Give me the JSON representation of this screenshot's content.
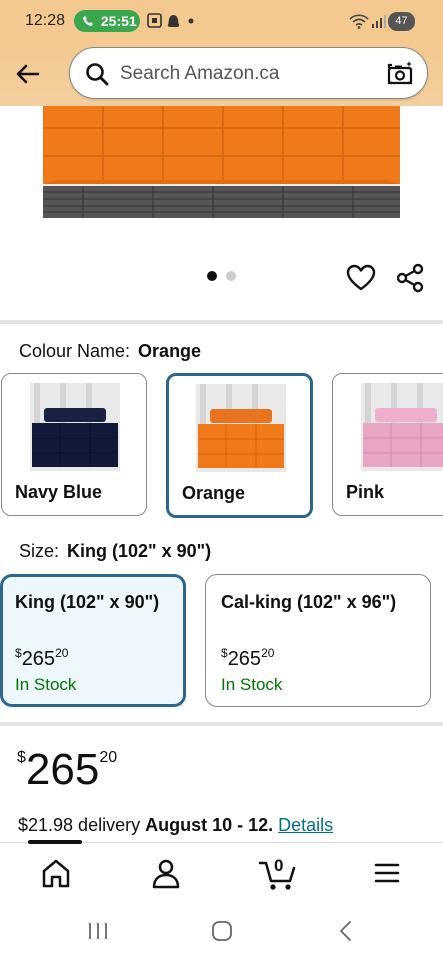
{
  "status_bar": {
    "time": "12:28",
    "call_timer": "25:51",
    "battery": "47"
  },
  "search": {
    "placeholder": "Search Amazon.ca"
  },
  "carousel": {
    "total_images": 2,
    "active_index": 0
  },
  "colour": {
    "label": "Colour Name:",
    "selected": "Orange",
    "options": [
      {
        "label": "Navy Blue",
        "color": "#12193a"
      },
      {
        "label": "Orange",
        "color": "#f07a1a"
      },
      {
        "label": "Pink",
        "color": "#e8a6c4"
      }
    ]
  },
  "size": {
    "label": "Size:",
    "selected": "King (102\" x 90\")",
    "options": [
      {
        "name": "King (102\" x 90\")",
        "currency": "$",
        "price_whole": "265",
        "price_fraction": "20",
        "stock": "In Stock"
      },
      {
        "name": "Cal-king (102\" x 96\")",
        "currency": "$",
        "price_whole": "265",
        "price_fraction": "20",
        "stock": "In Stock"
      }
    ]
  },
  "price": {
    "currency": "$",
    "whole": "265",
    "fraction": "20"
  },
  "delivery": {
    "fee": "$21.98 delivery",
    "dates": "August 10 - 12.",
    "details_link": "Details"
  },
  "bottom_nav": {
    "cart_count": "0",
    "items": [
      "home-icon",
      "account-icon",
      "cart-icon",
      "menu-icon"
    ]
  },
  "colors": {
    "header_bg": "#f3c98f",
    "selected_border": "#2a6690",
    "in_stock": "#007600",
    "link": "#00708a"
  }
}
